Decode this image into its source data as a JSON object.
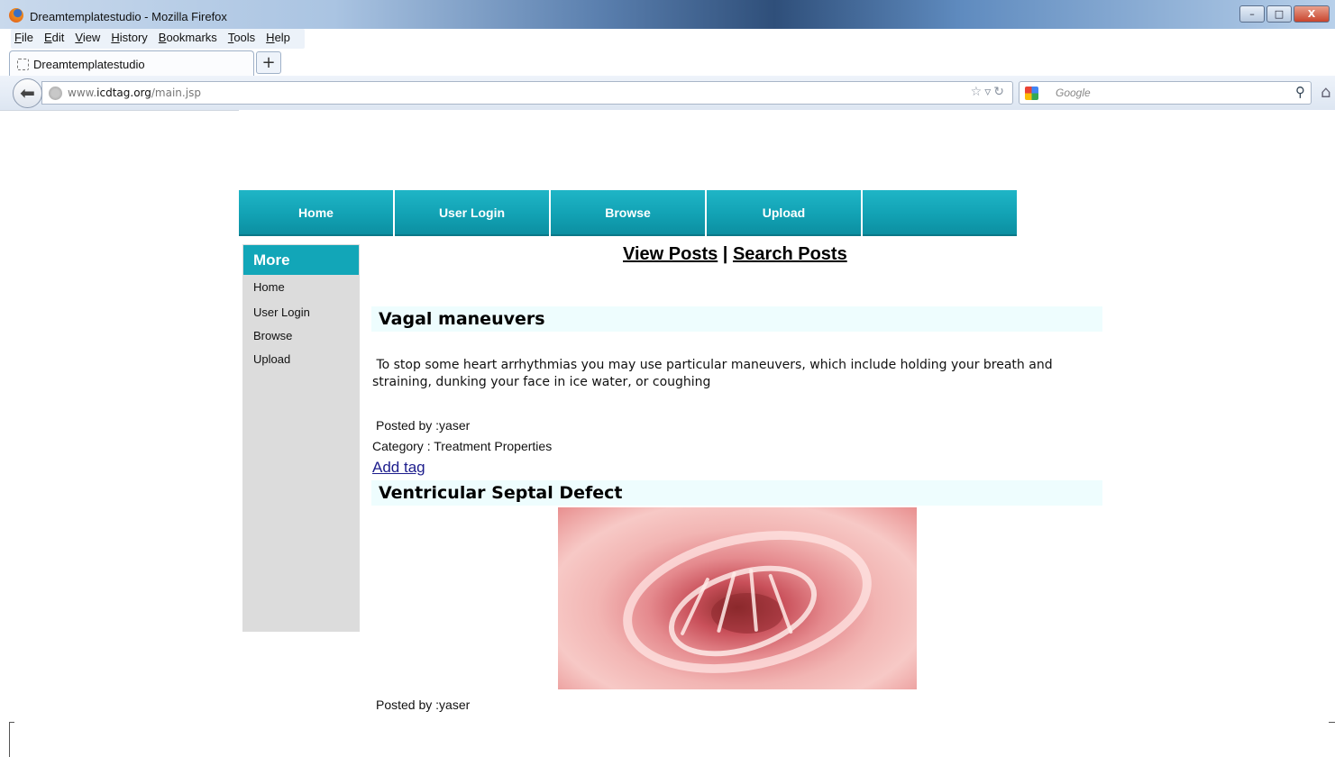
{
  "browser": {
    "window_title": "Dreamtemplatestudio - Mozilla Firefox",
    "menu": [
      "File",
      "Edit",
      "View",
      "History",
      "Bookmarks",
      "Tools",
      "Help"
    ],
    "tab_label": "Dreamtemplatestudio",
    "new_tab_label": "+",
    "url_prefix": "www.",
    "url_domain": "icdtag.org",
    "url_path": "/main.jsp",
    "search_placeholder": "Google",
    "controls": {
      "minimize": "–",
      "maximize": "□",
      "close": "X"
    },
    "icons": [
      "firefox-logo-icon",
      "back-arrow-icon",
      "globe-icon",
      "bookmark-star-icon",
      "history-dropdown-icon",
      "reload-icon",
      "google-icon",
      "search-icon",
      "home-icon"
    ]
  },
  "nav": {
    "items": [
      "Home",
      "User Login",
      "Browse",
      "Upload",
      ""
    ]
  },
  "sidebar": {
    "header": "More",
    "items": [
      "Home",
      "User Login",
      "Browse",
      "Upload"
    ]
  },
  "post_links": {
    "view": "View Posts",
    "separator": "|",
    "search": "Search Posts"
  },
  "posts": [
    {
      "title": "Vagal maneuvers",
      "body": "To stop some heart arrhythmias you may use particular maneuvers, which include holding your breath and straining, dunking your face in ice water, or coughing",
      "posted_by": "Posted by :yaser",
      "category": "Category : Treatment Properties",
      "add_tag": "Add tag"
    },
    {
      "title": "Ventricular Septal Defect",
      "posted_by": "Posted by :yaser"
    }
  ],
  "colors": {
    "nav_teal": "#12a2b4",
    "sidebar_gray": "#dcdcdc",
    "title_bar_bg": "#eefdfe",
    "link_blue": "#1c1c8c"
  }
}
